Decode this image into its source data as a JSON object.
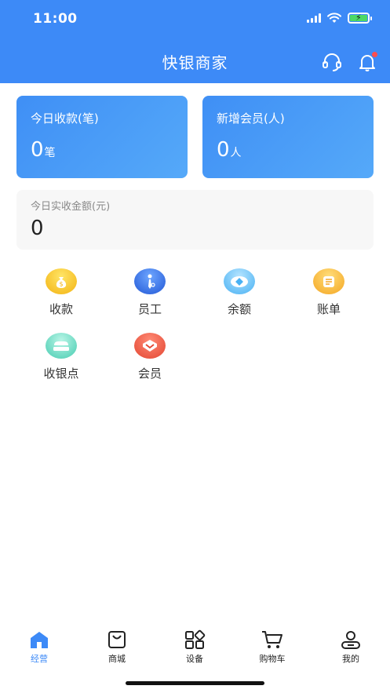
{
  "status_bar": {
    "time": "11:00"
  },
  "header": {
    "title": "快银商家"
  },
  "stats": {
    "today_payments": {
      "label": "今日收款(笔)",
      "value": "0",
      "unit": "笔"
    },
    "new_members": {
      "label": "新增会员(人)",
      "value": "0",
      "unit": "人"
    }
  },
  "income": {
    "label": "今日实收金额(元)",
    "value": "0"
  },
  "grid": [
    {
      "label": "收款",
      "icon": "money-bag-icon",
      "color": "#f3b313"
    },
    {
      "label": "员工",
      "icon": "employee-icon",
      "color": "#2258d6"
    },
    {
      "label": "余额",
      "icon": "balance-icon",
      "color": "#49b1f3"
    },
    {
      "label": "账单",
      "icon": "bill-icon",
      "color": "#f4a622"
    },
    {
      "label": "收银点",
      "icon": "cashier-point-icon",
      "color": "#48ccb1"
    },
    {
      "label": "会员",
      "icon": "member-icon",
      "color": "#e34632"
    }
  ],
  "tabbar": [
    {
      "label": "经营",
      "icon": "home-icon",
      "active": true
    },
    {
      "label": "商城",
      "icon": "shopping-bag-icon",
      "active": false
    },
    {
      "label": "设备",
      "icon": "grid-apps-icon",
      "active": false
    },
    {
      "label": "购物车",
      "icon": "cart-icon",
      "active": false
    },
    {
      "label": "我的",
      "icon": "profile-icon",
      "active": false
    }
  ],
  "colors": {
    "primary": "#3d8af7",
    "notification_dot": "#ff4d4f"
  }
}
